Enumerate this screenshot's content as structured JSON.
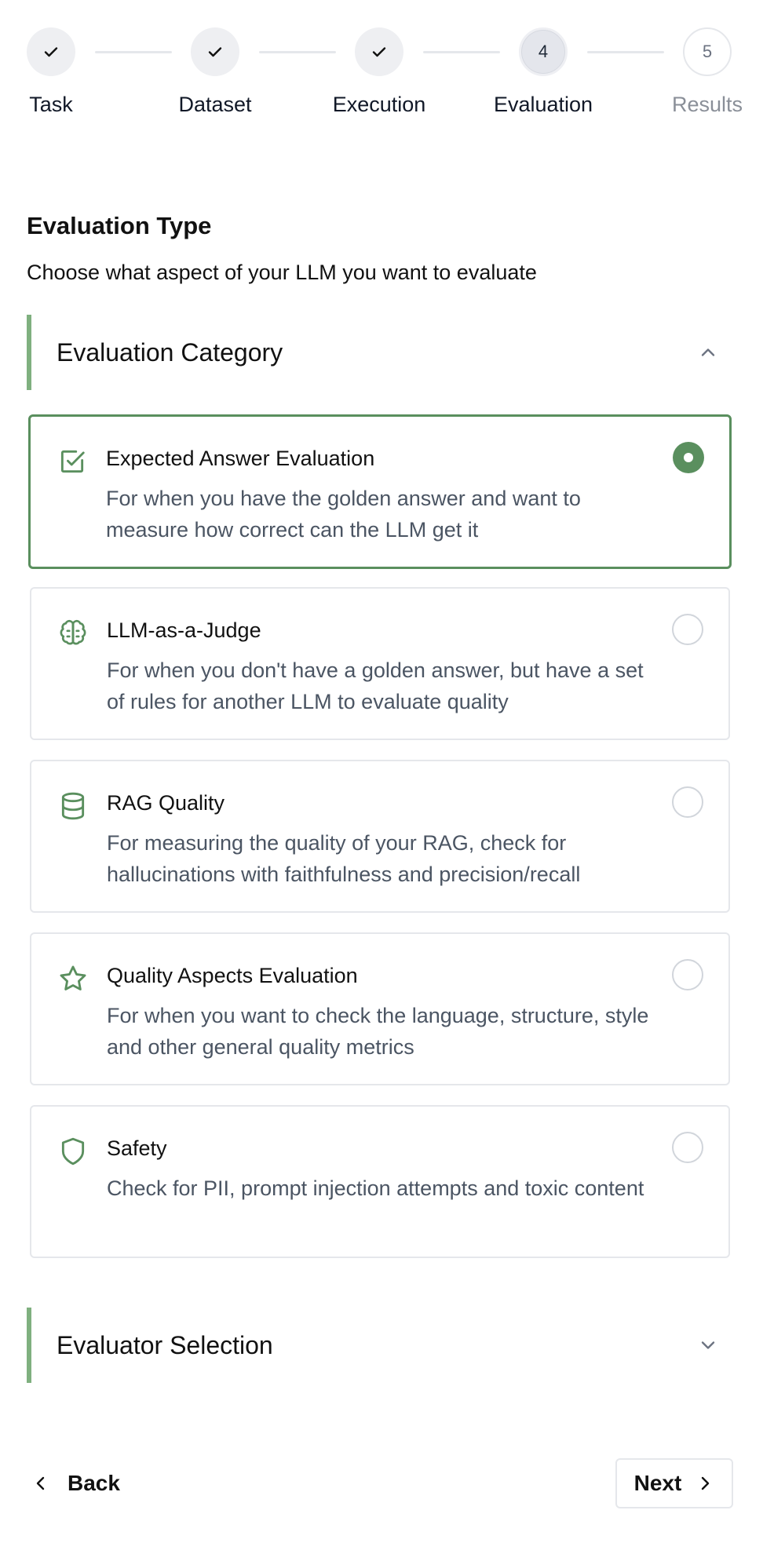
{
  "stepper": {
    "steps": [
      {
        "label": "Task",
        "state": "done"
      },
      {
        "label": "Dataset",
        "state": "done"
      },
      {
        "label": "Execution",
        "state": "done"
      },
      {
        "label": "Evaluation",
        "state": "current",
        "number": "4"
      },
      {
        "label": "Results",
        "state": "upcoming",
        "number": "5"
      }
    ]
  },
  "page": {
    "title": "Evaluation Type",
    "subtitle": "Choose what aspect of your LLM you want to evaluate"
  },
  "category_section": {
    "title": "Evaluation Category",
    "expanded": true,
    "options": [
      {
        "title": "Expected Answer Evaluation",
        "description": "For when you have the golden answer and want to measure how correct can the LLM get it",
        "icon": "checkbox-icon",
        "selected": true
      },
      {
        "title": "LLM-as-a-Judge",
        "description": "For when you don't have a golden answer, but have a set of rules for another LLM to evaluate quality",
        "icon": "brain-icon",
        "selected": false
      },
      {
        "title": "RAG Quality",
        "description": "For measuring the quality of your RAG, check for hallucinations with faithfulness and precision/recall",
        "icon": "database-icon",
        "selected": false
      },
      {
        "title": "Quality Aspects Evaluation",
        "description": "For when you want to check the language, structure, style and other general quality metrics",
        "icon": "star-icon",
        "selected": false
      },
      {
        "title": "Safety",
        "description": "Check for PII, prompt injection attempts and toxic content",
        "icon": "shield-icon",
        "selected": false
      }
    ]
  },
  "evaluator_section": {
    "title": "Evaluator Selection",
    "expanded": false
  },
  "footer": {
    "back_label": "Back",
    "next_label": "Next"
  },
  "colors": {
    "accent": "#5a8f5e",
    "section_bar": "#7fb07f",
    "muted_text": "#4b5563"
  }
}
